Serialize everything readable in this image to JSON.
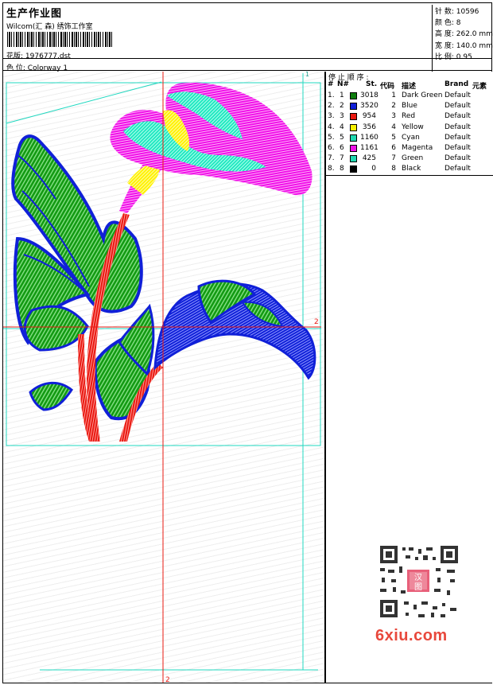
{
  "header": {
    "title": "生产作业图",
    "subtitle": "Wilcom(汇 森) 绣饰工作室",
    "design_label": "花版:",
    "design_value": "1976777.dst",
    "colorway_label": "色 位:",
    "colorway_value": "Colorway 1"
  },
  "stats": {
    "stitches": "针 数: 10596",
    "colors": "颜 色: 8",
    "height": "高 度: 262.0 mm",
    "width": "宽 度: 140.0 mm",
    "scale": "比 例: 0.95"
  },
  "canvas": {
    "hoop_marker_1": "1",
    "hoop_marker_2": "2",
    "axis_marker_2": "2"
  },
  "stop_sequence": {
    "title": "停 止 顺 序 :",
    "headers": {
      "hash": "#",
      "num": "N#",
      "st": "St.",
      "code": "代码",
      "desc": "描述",
      "brand": "Brand",
      "element": "元素"
    },
    "rows": [
      {
        "hash": "1.",
        "num": "1",
        "st": "3018",
        "code": "1",
        "desc": "Dark Green",
        "brand": "Default",
        "color": "#0d7d0d"
      },
      {
        "hash": "2.",
        "num": "2",
        "st": "3520",
        "code": "2",
        "desc": "Blue",
        "brand": "Default",
        "color": "#1020d8"
      },
      {
        "hash": "3.",
        "num": "3",
        "st": "954",
        "code": "3",
        "desc": "Red",
        "brand": "Default",
        "color": "#e81810"
      },
      {
        "hash": "4.",
        "num": "4",
        "st": "356",
        "code": "4",
        "desc": "Yellow",
        "brand": "Default",
        "color": "#f6f000"
      },
      {
        "hash": "5.",
        "num": "5",
        "st": "1160",
        "code": "5",
        "desc": "Cyan",
        "brand": "Default",
        "color": "#20d8b0"
      },
      {
        "hash": "6.",
        "num": "6",
        "st": "1161",
        "code": "6",
        "desc": "Magenta",
        "brand": "Default",
        "color": "#f010e8"
      },
      {
        "hash": "7.",
        "num": "7",
        "st": "425",
        "code": "7",
        "desc": "Green",
        "brand": "Default",
        "color": "#20d8b0"
      },
      {
        "hash": "8.",
        "num": "8",
        "st": "0",
        "code": "8",
        "desc": "Black",
        "brand": "Default",
        "color": "#000000"
      }
    ]
  },
  "watermark": {
    "logo": "6xiu.com",
    "badge_top": "汉",
    "badge_bottom": "图"
  },
  "colors": {
    "frame": "#000000",
    "guide": "#20d8c0",
    "axis": "#e81810"
  }
}
